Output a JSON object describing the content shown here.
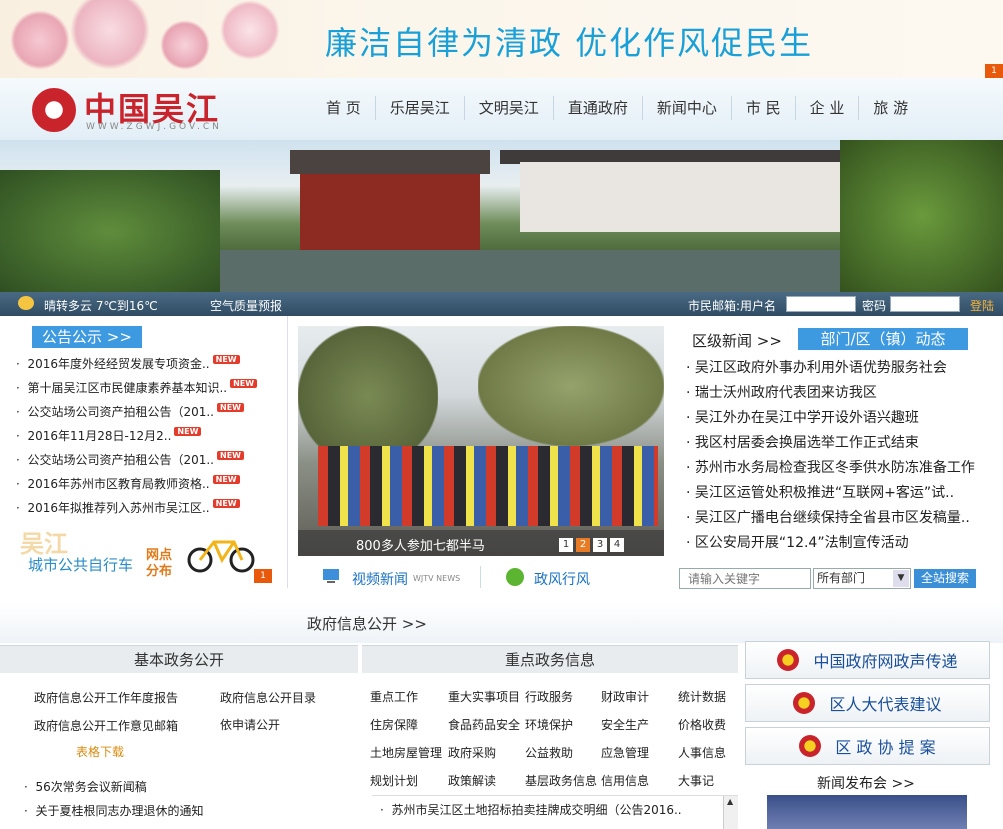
{
  "banner": {
    "slogan": "廉洁自律为清政   优化作风促民生",
    "badge": "1"
  },
  "header": {
    "logo_text": "中国吴江",
    "logo_url": "WWW.ZGWJ.GOV.CN"
  },
  "nav": [
    "首 页",
    "乐居吴江",
    "文明吴江",
    "直通政府",
    "新闻中心",
    "市 民",
    "企 业",
    "旅 游"
  ],
  "infobar": {
    "weather": "晴转多云  7℃到16℃",
    "air": "空气质量预报",
    "mail_label": "市民邮箱:用户名",
    "password_label": "密码",
    "login": "登陆"
  },
  "gonggao": {
    "title": "公告公示 >>",
    "items": [
      "2016年度外经经贸发展专项资金..",
      "第十届吴江区市民健康素养基本知识..",
      "公交站场公司资产拍租公告（201..",
      "2016年11月28日-12月2..",
      "公交站场公司资产拍租公告（201..",
      "2016年苏州市区教育局教师资格..",
      "2016年拟推荐列入苏州市吴江区.."
    ],
    "new_label": "NEW",
    "bike_label": "城市公共自行车",
    "bike_sub1": "网点",
    "bike_sub2": "分布",
    "bike_bg": "吴江",
    "badge": "1"
  },
  "photo": {
    "caption": "800多人参加七都半马",
    "pages": [
      "1",
      "2",
      "3",
      "4"
    ]
  },
  "media": {
    "video": "视频新闻",
    "video_sub": "WJTV NEWS",
    "wind": "政风行风"
  },
  "district": {
    "title": "区级新闻 >>",
    "dept_title": "部门/区（镇）动态 >>",
    "items": [
      "吴江区政府外事办利用外语优势服务社会",
      "瑞士沃州政府代表团来访我区",
      "吴江外办在吴江中学开设外语兴趣班",
      "我区村居委会换届选举工作正式结束",
      "苏州市水务局检查我区冬季供水防冻准备工作",
      "吴江区运管处积极推进“互联网+客运”试..",
      "吴江区广播电台继续保持全省县市区发稿量..",
      "区公安局开展“12.4”法制宣传活动"
    ]
  },
  "search": {
    "placeholder": "请输入关键字",
    "dept": "所有部门",
    "button": "全站搜索"
  },
  "gov": {
    "title": "政府信息公开 >>",
    "basic_title": "基本政务公开",
    "key_title": "重点政务信息",
    "basic_links": [
      "政府信息公开工作年度报告",
      "政府信息公开目录",
      "政府信息公开工作意见邮箱",
      "依申请公开",
      "表格下载"
    ],
    "key_links": [
      "重点工作",
      "重大实事项目",
      "行政服务",
      "财政审计",
      "统计数据",
      "住房保障",
      "食品药品安全",
      "环境保护",
      "安全生产",
      "价格收费",
      "土地房屋管理",
      "政府采购",
      "公益救助",
      "应急管理",
      "人事信息",
      "规划计划",
      "政策解读",
      "基层政务信息",
      "信用信息",
      "大事记"
    ],
    "basic_news": [
      "56次常务会议新闻稿",
      "关于夏桂根同志办理退休的通知"
    ],
    "key_news": [
      "苏州市吴江区土地招标拍卖挂牌成交明细（公告2016.."
    ]
  },
  "right": {
    "btn1": "中国政府网政声传递",
    "btn2": "区人大代表建议",
    "btn3": "区 政 协 提 案",
    "press": "新闻发布会 >>"
  }
}
